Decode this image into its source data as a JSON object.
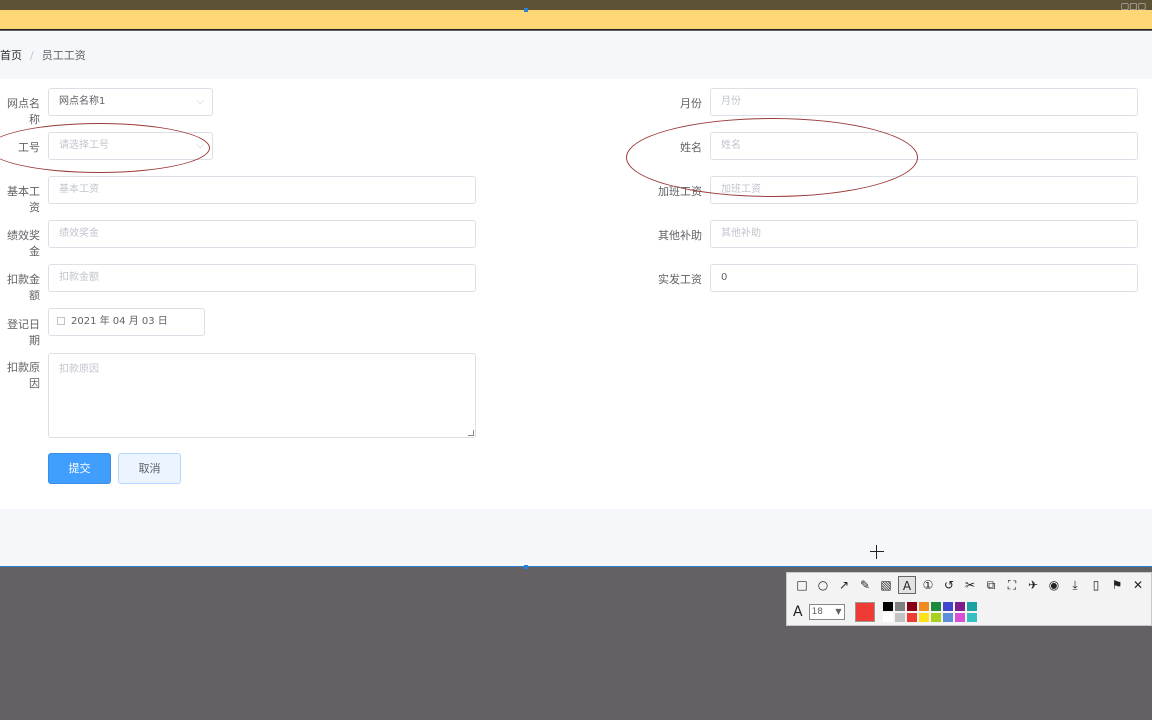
{
  "breadcrumb": {
    "home": "首页",
    "separator": "/",
    "current": "员工工资"
  },
  "form": {
    "branch_name": {
      "label": "网点名称",
      "value": "网点名称1"
    },
    "month": {
      "label": "月份",
      "placeholder": "月份"
    },
    "employee_id": {
      "label": "工号",
      "placeholder": "请选择工号"
    },
    "name": {
      "label": "姓名",
      "placeholder": "姓名"
    },
    "base_salary": {
      "label": "基本工资",
      "placeholder": "基本工资"
    },
    "overtime_pay": {
      "label": "加班工资",
      "placeholder": "加班工资"
    },
    "performance_bonus": {
      "label": "绩效奖金",
      "placeholder": "绩效奖金"
    },
    "other_subsidy": {
      "label": "其他补助",
      "placeholder": "其他补助"
    },
    "deduction_amount": {
      "label": "扣款金额",
      "placeholder": "扣款金额"
    },
    "actual_salary": {
      "label": "实发工资",
      "value": "0"
    },
    "register_date": {
      "label": "登记日期",
      "value": "2021 年 04 月 03 日"
    },
    "deduction_reason": {
      "label": "扣款原因",
      "placeholder": "扣款原因"
    }
  },
  "buttons": {
    "submit": "提交",
    "cancel": "取消"
  },
  "annotation_toolbar": {
    "font_size": "18",
    "tools": [
      "rectangle-icon",
      "ellipse-icon",
      "arrow-icon",
      "pencil-icon",
      "mosaic-icon",
      "text-icon",
      "number-icon",
      "undo-icon",
      "cut-icon",
      "copy-icon",
      "select-icon",
      "pin-icon",
      "record-icon",
      "download-icon",
      "phone-icon",
      "bookmark-icon",
      "close-icon"
    ],
    "current_color": "#ee3b34",
    "palette": [
      "#000000",
      "#7f7f7f",
      "#880015",
      "#f08c1f",
      "#1f8a3b",
      "#3f48cc",
      "#7c1e8c",
      "#1aa3a3",
      "#ffffff",
      "#c3c3c3",
      "#ee3b34",
      "#ffe01a",
      "#a7d11c",
      "#5b8fd9",
      "#d64fd6",
      "#33c1c1"
    ]
  },
  "colors": {
    "accent": "#409eff",
    "annotation_ellipse": "#9b3a3a"
  }
}
